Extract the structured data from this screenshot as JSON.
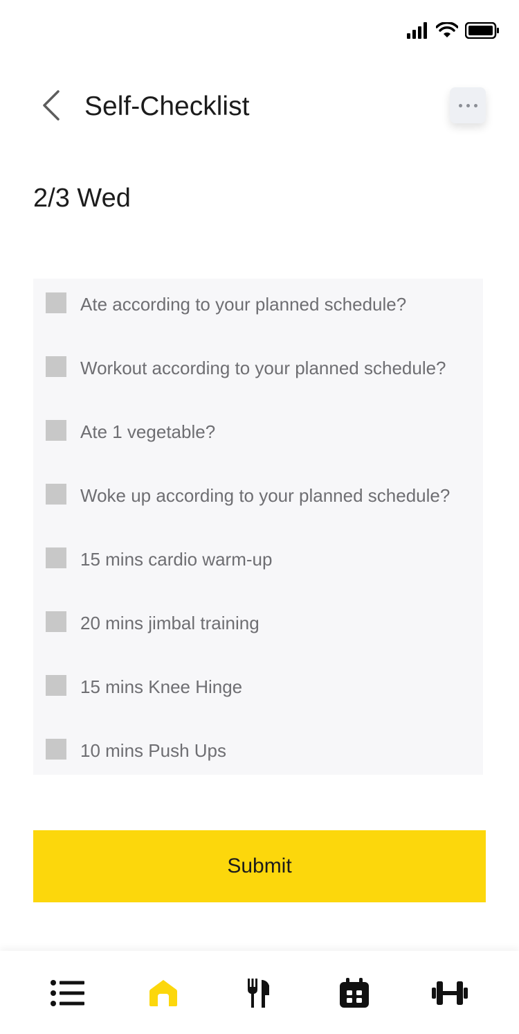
{
  "header": {
    "title": "Self-Checklist",
    "back_icon": "chevron-left-icon",
    "more_icon": "more-horizontal-icon"
  },
  "date_label": "2/3 Wed",
  "checklist": {
    "items": [
      {
        "label": "Ate according to your planned schedule?",
        "checked": false
      },
      {
        "label": "Workout according to your planned schedule?",
        "checked": false
      },
      {
        "label": "Ate 1 vegetable?",
        "checked": false
      },
      {
        "label": "Woke up according to your planned schedule?",
        "checked": false
      },
      {
        "label": "15 mins cardio warm-up",
        "checked": false
      },
      {
        "label": "20 mins jimbal training",
        "checked": false
      },
      {
        "label": "15 mins Knee Hinge",
        "checked": false
      },
      {
        "label": "10 mins Push Ups",
        "checked": false
      }
    ]
  },
  "submit_label": "Submit",
  "tab_bar": {
    "tabs": [
      {
        "icon": "list-icon",
        "active": false
      },
      {
        "icon": "home-icon",
        "active": true
      },
      {
        "icon": "fork-knife-icon",
        "active": false
      },
      {
        "icon": "calendar-icon",
        "active": false
      },
      {
        "icon": "dumbbell-icon",
        "active": false
      }
    ]
  },
  "colors": {
    "accent": "#fcd70c",
    "checkbox": "#c8c8c8",
    "list_bg": "#f7f7f9",
    "icon_dark": "#111111"
  }
}
